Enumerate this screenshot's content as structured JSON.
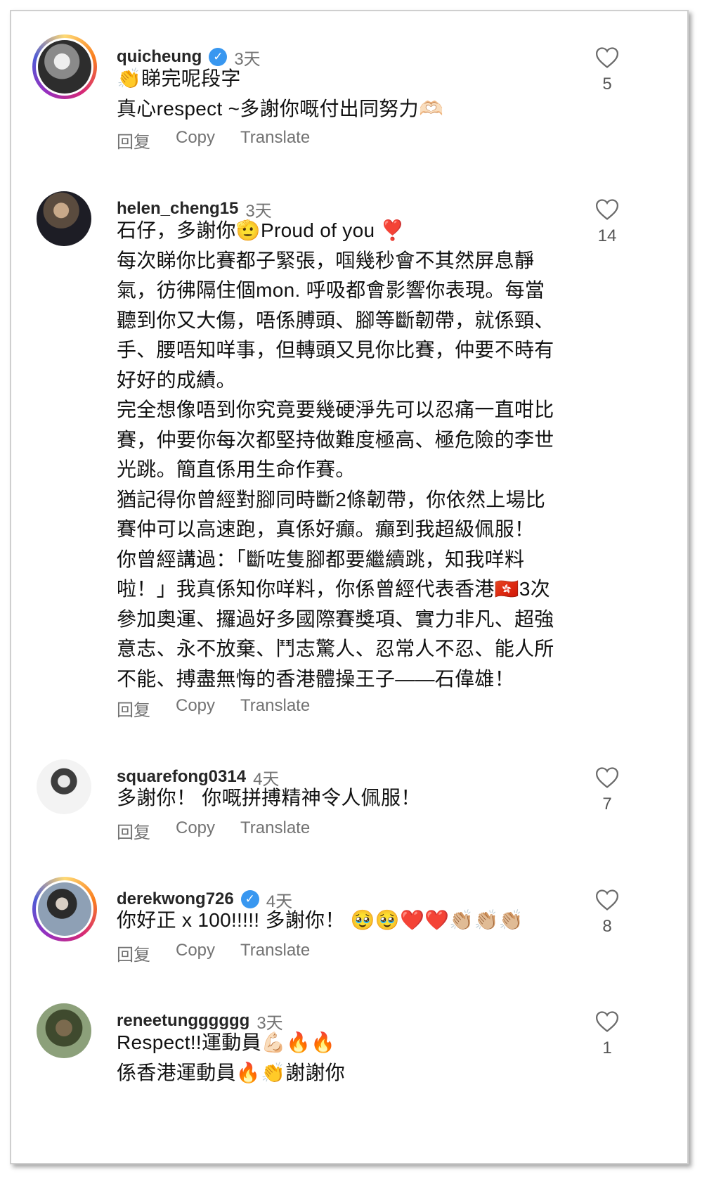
{
  "actions": {
    "reply": "回复",
    "copy": "Copy",
    "translate": "Translate"
  },
  "comments": [
    {
      "username": "quicheung",
      "verified": true,
      "time": "3天",
      "text": "👏睇完呢段字\n真心respect ~多謝你嘅付出同努力🫶🏻",
      "likes": "5"
    },
    {
      "username": "helen_cheng15",
      "verified": false,
      "time": "3天",
      "text": "石仔，多謝你🫡Proud of you ❣️\n每次睇你比賽都子緊張，啯幾秒會不其然屏息靜\n氣，彷彿隔住個mon. 呼吸都會影響你表現。每當\n聽到你又大傷，唔係膊頭、腳等斷韌帶，就係頸、\n手、腰唔知咩事，但轉頭又見你比賽，仲要不時有\n好好的成績。\n完全想像唔到你究竟要幾硬淨先可以忍痛一直咁比\n賽，仲要你每次都堅持做難度極高、極危險的李世\n光跳。簡直係用生命作賽。\n猶記得你曾經對腳同時斷2條韌帶，你依然上場比\n賽仲可以高速跑，真係好癲。癲到我超級佩服！\n你曾經講過：「斷咗隻腳都要繼續跳，知我咩料\n啦！」我真係知你咩料，你係曾經代表香港🇭🇰3次\n參加奧運、攞過好多國際賽獎項、實力非凡、超強\n意志、永不放棄、鬥志驚人、忍常人不忍、能人所\n不能、搏盡無悔的香港體操王子——石偉雄！",
      "likes": "14"
    },
    {
      "username": "squarefong0314",
      "verified": false,
      "time": "4天",
      "text": "多謝你！ 你嘅拼搏精神令人佩服！",
      "likes": "7"
    },
    {
      "username": "derekwong726",
      "verified": true,
      "time": "4天",
      "text": "你好正 x 100!!!!! 多謝你！ 🥹🥹❤️❤️👏🏼👏🏼👏🏼",
      "likes": "8"
    },
    {
      "username": "reneetungggggg",
      "verified": false,
      "time": "3天",
      "text": "Respect!!運動員💪🏻🔥🔥\n係香港運動員🔥👏謝謝你",
      "likes": "1"
    }
  ]
}
